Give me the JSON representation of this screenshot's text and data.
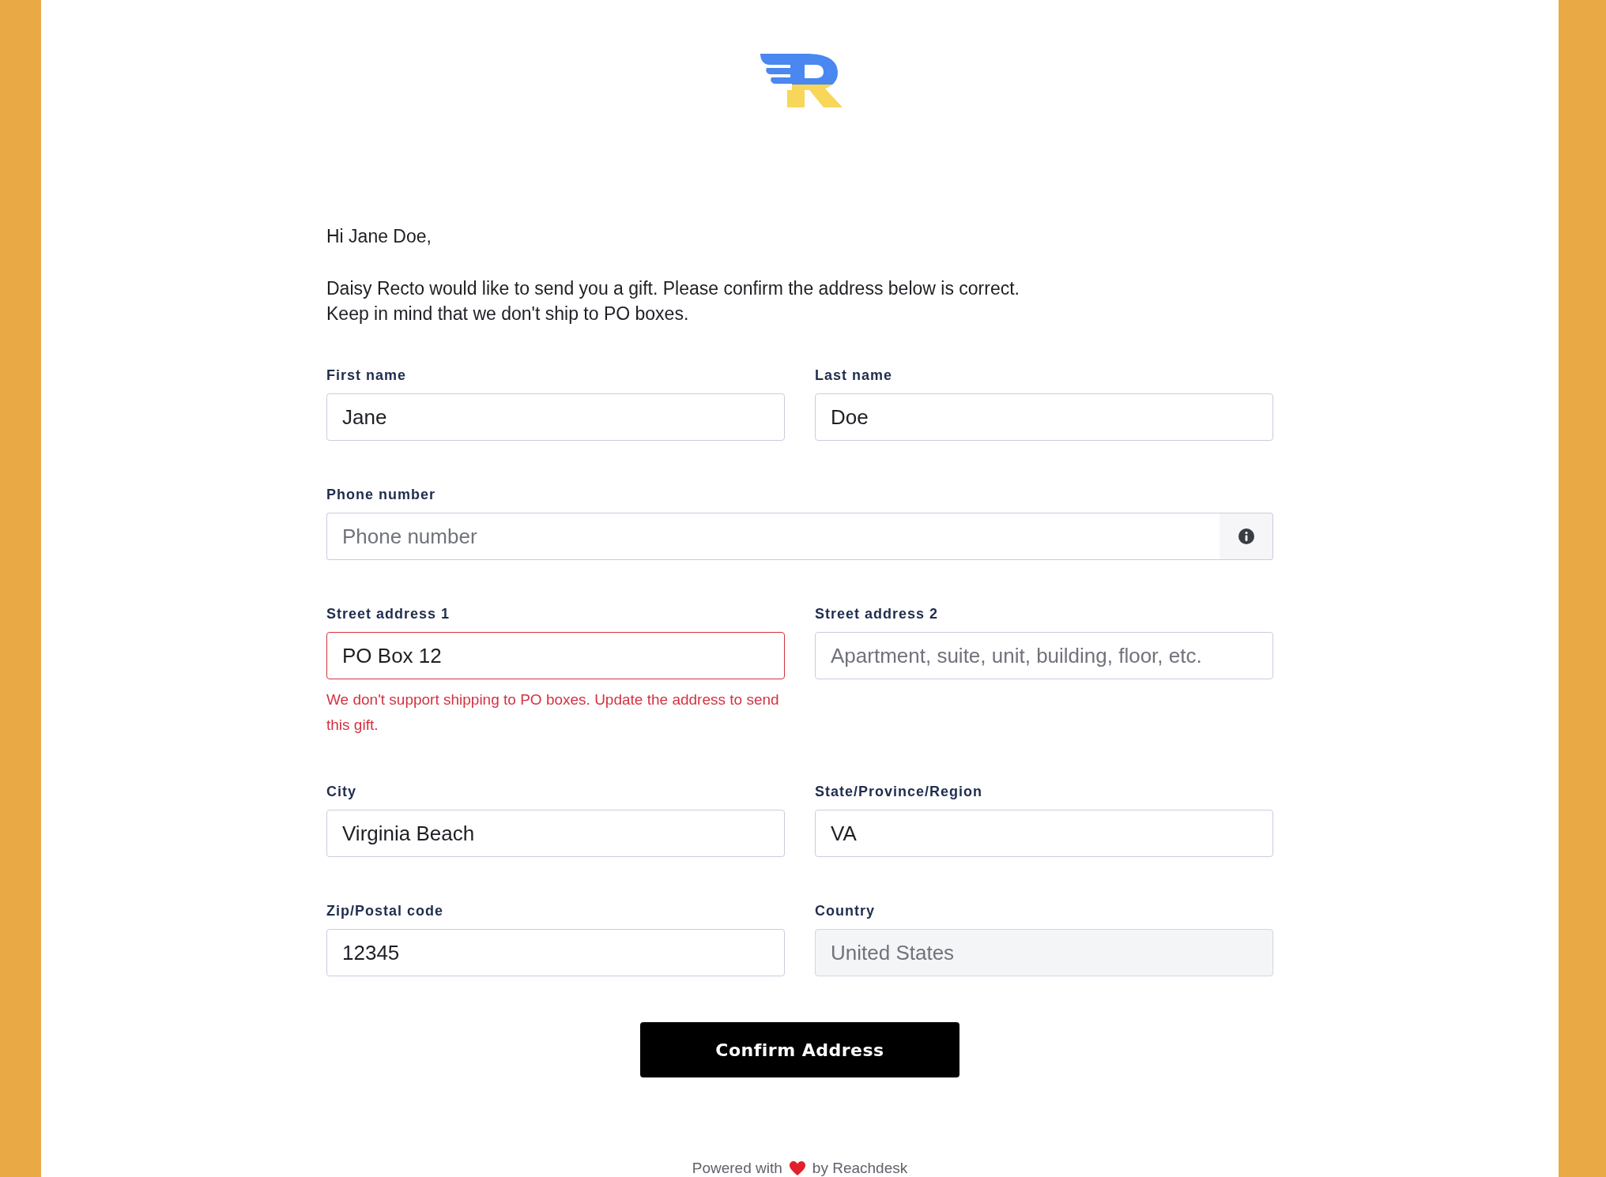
{
  "greeting": "Hi Jane Doe,",
  "message": [
    "Daisy Recto would like to send you a gift. Please confirm the address below is correct.",
    "Keep in mind that we don't ship to PO boxes."
  ],
  "form_rows": [
    [
      {
        "label": "First name",
        "value": "Jane",
        "invalid": false,
        "disabled": false,
        "kind": "text"
      },
      {
        "label": "Last name",
        "value": "Doe",
        "invalid": false,
        "disabled": false,
        "kind": "text"
      }
    ],
    [
      {
        "label": "Phone number",
        "placeholder": "Phone number",
        "invalid": false,
        "disabled": false,
        "kind": "info"
      }
    ],
    [
      {
        "label": "Street address 1",
        "value": "PO Box 12",
        "invalid": true,
        "disabled": false,
        "kind": "text",
        "error": "We don't support shipping to PO boxes. Update the address to send this gift."
      },
      {
        "label": "Street address 2",
        "placeholder": "Apartment, suite, unit, building, floor, etc.",
        "invalid": false,
        "disabled": false,
        "kind": "text"
      }
    ],
    [
      {
        "label": "City",
        "value": "Virginia Beach",
        "invalid": false,
        "disabled": false,
        "kind": "text"
      },
      {
        "label": "State/Province/Region",
        "value": "VA",
        "invalid": false,
        "disabled": false,
        "kind": "text"
      }
    ],
    [
      {
        "label": "Zip/Postal code",
        "value": "12345",
        "invalid": false,
        "disabled": false,
        "kind": "text"
      },
      {
        "label": "Country",
        "value": "United States",
        "invalid": false,
        "disabled": true,
        "kind": "text"
      }
    ]
  ],
  "confirm_button": "Confirm Address",
  "footer": {
    "before": "Powered with",
    "after": "by Reachdesk"
  }
}
